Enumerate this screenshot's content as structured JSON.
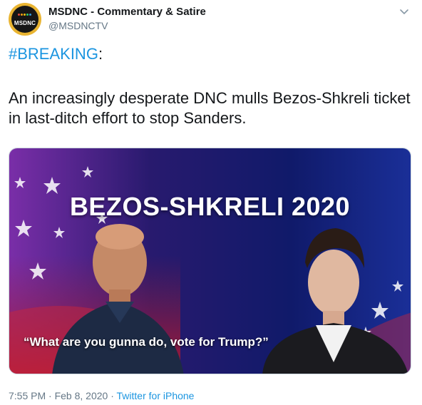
{
  "author": {
    "display_name": "MSDNC - Commentary & Satire",
    "handle": "@MSDNCTV",
    "avatar_logo_text": "MSDNC"
  },
  "menu_icon": "chevron-down-icon",
  "tweet": {
    "hashtag": "#BREAKING",
    "hashtag_suffix": ":",
    "body": "An increasingly desperate DNC mulls Bezos-Shkreli ticket in last-ditch effort to stop Sanders."
  },
  "media": {
    "headline": "BEZOS-SHKRELI 2020",
    "quote": "“What are you gunna do, vote for Trump?”"
  },
  "meta": {
    "time": "7:55 PM",
    "separator1": " · ",
    "date": "Feb 8, 2020",
    "separator2": " · ",
    "source": "Twitter for iPhone"
  },
  "colors": {
    "link": "#1b95e0",
    "secondary_text": "#657786",
    "primary_text": "#14171a",
    "avatar_ring": "#e9b431"
  }
}
